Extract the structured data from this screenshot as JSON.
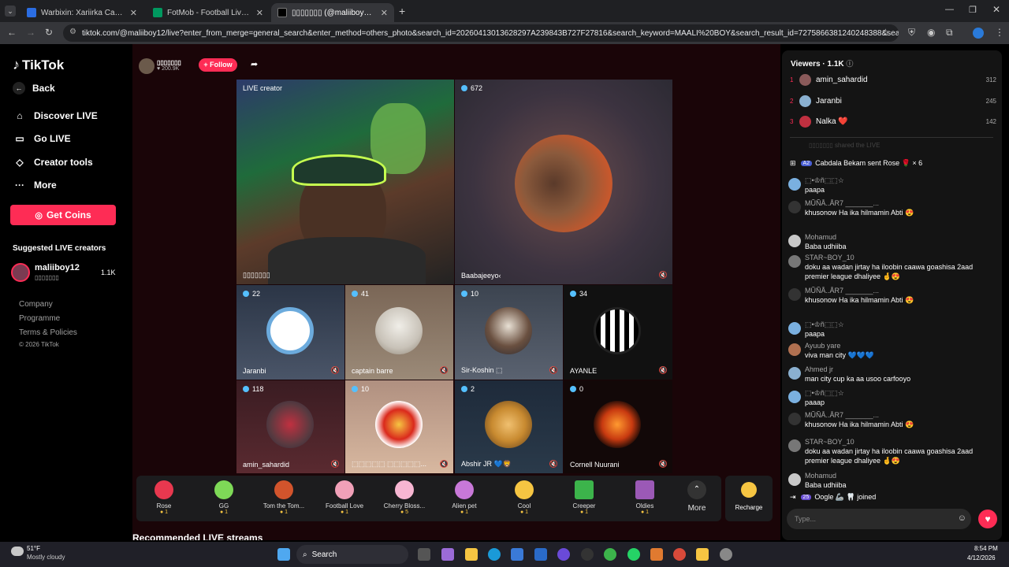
{
  "browser": {
    "tabs": [
      {
        "title": "Warbixin: Xariirka Caymiska ee...",
        "color": "#2b6de2"
      },
      {
        "title": "FotMob - Football Live Scores",
        "color": "#00985f"
      },
      {
        "title": "▯▯▯▯▯▯▯ (@maliiboy12) i...",
        "color": "#000000"
      }
    ],
    "url": "tiktok.com/@maliiboy12/live?enter_from_merge=general_search&enter_method=others_photo&search_id=20260413013628297A239843B727F27816&search_keyword=MAALI%20BOY&search_result_id=7275866381240248388&search_type=..."
  },
  "sidebar": {
    "logo": "TikTok",
    "back": "Back",
    "nav": [
      {
        "label": "Discover LIVE",
        "icon": "broadcast-icon"
      },
      {
        "label": "Go LIVE",
        "icon": "camera-icon"
      },
      {
        "label": "Creator tools",
        "icon": "lightbulb-icon"
      },
      {
        "label": "More",
        "icon": "more-icon"
      }
    ],
    "get_coins": "Get Coins",
    "suggested_title": "Suggested LIVE creators",
    "creator": {
      "name": "maliiboy12",
      "sub": "▯▯▯▯▯▯▯",
      "count": "1.1K"
    },
    "footer": [
      "Company",
      "Programme",
      "Terms & Policies",
      "© 2026 TikTok"
    ]
  },
  "host": {
    "name": "▯▯▯▯▯▯▯",
    "likes": "200.9K",
    "follow": "+ Follow"
  },
  "tiles": {
    "main": {
      "label": "LIVE creator",
      "name": "▯▯▯▯▯▯▯"
    },
    "second": {
      "count": "672",
      "name": "Baabajeeyo‹"
    },
    "grid": [
      {
        "count": "22",
        "name": "Jaranbi"
      },
      {
        "count": "41",
        "name": "captain barre"
      },
      {
        "count": "10",
        "name": "Sir-Koshin ⬚"
      },
      {
        "count": "34",
        "name": "AYANLE"
      },
      {
        "count": "118",
        "name": "amin_sahardid"
      },
      {
        "count": "10",
        "name": "⬚⬚⬚⬚⬚ ⬚⬚⬚⬚⬚..."
      },
      {
        "count": "2",
        "name": "Abshir JR 💙🦁"
      },
      {
        "count": "0",
        "name": "Cornell Nuurani"
      }
    ]
  },
  "gifts": [
    {
      "name": "Rose",
      "price": "1",
      "color": "#e8384f"
    },
    {
      "name": "GG",
      "price": "1",
      "color": "#7ed957"
    },
    {
      "name": "Tom the Tom...",
      "price": "1",
      "color": "#d2542c"
    },
    {
      "name": "Football Love",
      "price": "1",
      "color": "#f0a0b8"
    },
    {
      "name": "Cherry Bloss...",
      "price": "5",
      "color": "#f7b6d2"
    },
    {
      "name": "Alien pet",
      "price": "1",
      "color": "#c878d8"
    },
    {
      "name": "Cool",
      "price": "1",
      "color": "#f6c542"
    },
    {
      "name": "Creeper",
      "price": "1",
      "color": "#3cb44b"
    },
    {
      "name": "Oldies",
      "price": "1",
      "color": "#9b59b6"
    }
  ],
  "gift_more": "More",
  "recharge": "Recharge",
  "viewers": {
    "title": "Viewers · 1.1K",
    "list": [
      {
        "rank": "1",
        "name": "amin_sahardid",
        "score": "312"
      },
      {
        "rank": "2",
        "name": "Jaranbi",
        "score": "245"
      },
      {
        "rank": "3",
        "name": "Nalka ❤️",
        "score": "142"
      }
    ]
  },
  "chat": {
    "shared": "▯▯▯▯▯▯▯ shared the LIVE",
    "gift_line": "Cabdala Bekam sent Rose 🌹 × 6",
    "messages": [
      {
        "user": "⬚•♔ñ⬚⬚☆",
        "text": "paapa"
      },
      {
        "user": "MŨÑÅ..ÅR7 _______...",
        "text": "khusonow Ha ika hilmamin Abti 😍"
      },
      {
        "user": "Mohamud",
        "text": "Baba udhiiba"
      },
      {
        "user": "STAR~BOY_10",
        "text": "doku aa wadan jirtay ha iloobin caawa goashisa 2aad premier league dhaliyee 🤞😍"
      },
      {
        "user": "MŨÑÅ..ÅR7 _______...",
        "text": "khusonow Ha ika hilmamin Abti 😍"
      },
      {
        "user": "⬚•♔ñ⬚⬚☆",
        "text": "paapa"
      },
      {
        "user": "Ayuub yare",
        "text": "viva man city 💙💙💙"
      },
      {
        "user": "Ahmed jr",
        "text": "man city cup ka aa usoo carfooyo"
      },
      {
        "user": "⬚•♔ñ⬚⬚☆",
        "text": "paaap"
      },
      {
        "user": "MŨÑÅ..ÅR7 _______...",
        "text": "khusonow Ha ika hilmamin Abti 😍"
      },
      {
        "user": "STAR~BOY_10",
        "text": "doku aa wadan jirtay ha iloobin caawa goashisa 2aad premier league dhaliyee 🤞😍"
      },
      {
        "user": "Mohamud",
        "text": "Baba udhiiba"
      }
    ],
    "joined": "Oogle 🦾 🦷  joined",
    "input_placeholder": "Type..."
  },
  "recommended": "Recommended LIVE streams",
  "taskbar": {
    "weather_temp": "51°F",
    "weather_desc": "Mostly cloudy",
    "search": "Search",
    "time": "8:54 PM",
    "date": "4/12/2026"
  }
}
